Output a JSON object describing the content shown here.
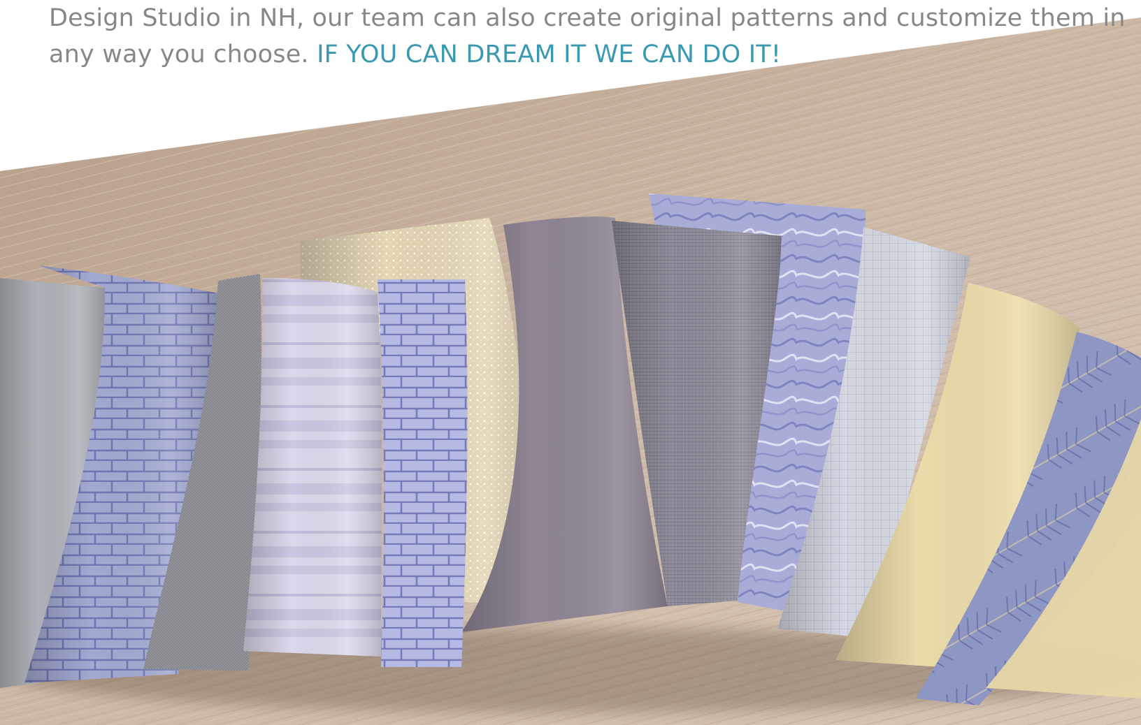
{
  "intro": {
    "line1": "Design Studio in NH, our team can also create original patterns and customize them in",
    "line2_plain": "any way you choose. ",
    "line2_accent": "IF YOU CAN DREAM IT WE CAN DO IT!"
  },
  "colors": {
    "body_text": "#85888a",
    "accent": "#3a99b0",
    "wood": "#c8b2a0"
  },
  "photo": {
    "subject": "fan of wallcovering sample swatches on a wooden table",
    "swatches": [
      {
        "name": "swatch-solid-grey",
        "color": "#aeb2b8"
      },
      {
        "name": "swatch-periwinkle-brick",
        "color": "#a3a9d2"
      },
      {
        "name": "swatch-grey-linen",
        "color": "#8d8e94"
      },
      {
        "name": "swatch-lavender-stripe",
        "color": "#ddd9ec"
      },
      {
        "name": "swatch-blue-stone",
        "color": "#b5b9e3"
      },
      {
        "name": "swatch-cream-dot",
        "color": "#e3d6b5"
      },
      {
        "name": "swatch-mauve-solid",
        "color": "#8f8594"
      },
      {
        "name": "swatch-grey-weave",
        "color": "#8c8a96"
      },
      {
        "name": "swatch-blue-marble",
        "color": "#a8acd6"
      },
      {
        "name": "swatch-white-grid",
        "color": "#d5d8e0"
      },
      {
        "name": "swatch-butter-solid",
        "color": "#ecdcaa"
      },
      {
        "name": "swatch-blue-palm",
        "color": "#8e96c4"
      }
    ]
  }
}
